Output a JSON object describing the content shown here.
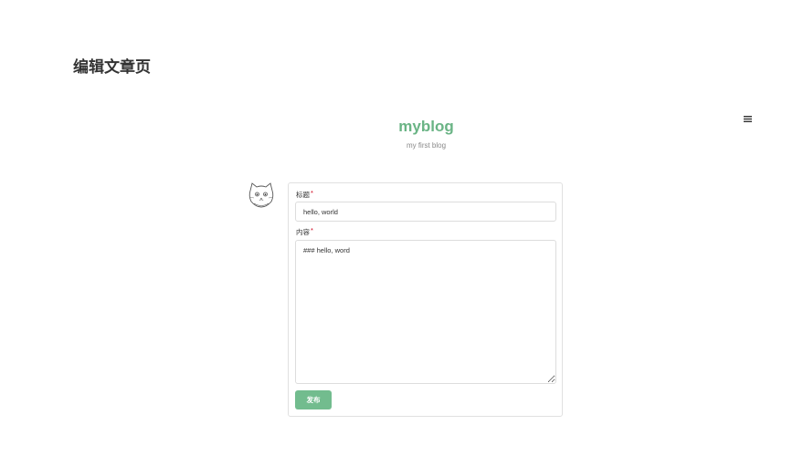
{
  "page": {
    "title": "编辑文章页"
  },
  "site": {
    "name": "myblog",
    "tagline": "my first blog",
    "accent_color": "#6ab485"
  },
  "menu": {
    "icon": "hamburger-menu-icon"
  },
  "avatar": {
    "icon": "cat-face-icon"
  },
  "editor": {
    "title_label": "标题",
    "content_label": "内容",
    "required_mark": "*",
    "title_value": "hello, world",
    "content_value": "### hello, word",
    "publish_label": "发布",
    "publish_color": "#72bc8e",
    "required_color": "#d0021b"
  }
}
